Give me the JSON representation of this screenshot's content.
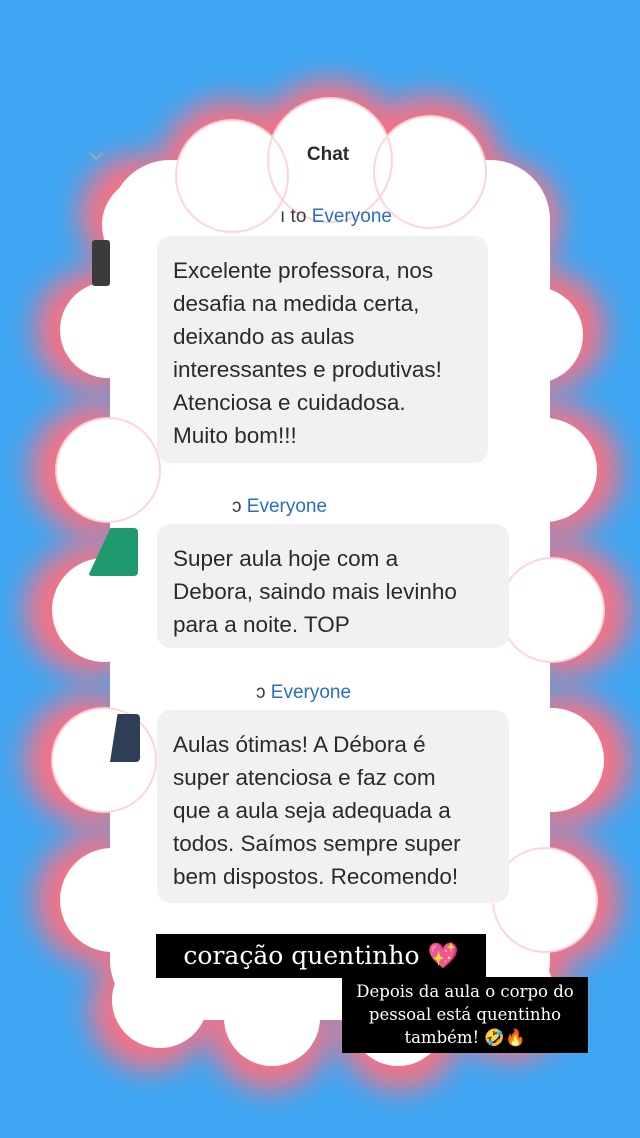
{
  "chat": {
    "title": "Chat",
    "messages": [
      {
        "to_prefix": "ı to",
        "recipient": "Everyone",
        "lines": [
          "Excelente professora, nos",
          "desafia na medida certa,",
          "deixando as aulas",
          "interessantes e produtivas!",
          "Atenciosa e  cuidadosa.",
          "Muito bom!!!"
        ]
      },
      {
        "to_prefix": "ɔ",
        "recipient": "Everyone",
        "lines": [
          "Super aula hoje com a",
          "Debora, saindo mais levinho",
          "para a noite. TOP"
        ]
      },
      {
        "to_prefix": "ɔ",
        "recipient": "Everyone",
        "lines": [
          "Aulas ótimas! A Débora é",
          "super atenciosa e faz com",
          "que a aula seja adequada a",
          "todos. Saímos sempre super",
          "bem dispostos. Recomendo!"
        ]
      }
    ]
  },
  "overlay": {
    "caption": "coração quentinho 💖",
    "subcaption_lines": [
      "Depois da aula o corpo do",
      "pessoal está quentinho",
      "também! 🤣🔥"
    ]
  },
  "colors": {
    "background": "#3ea6f2",
    "cloud_glow": "#ff6f7f",
    "bubble": "#f1f1f4",
    "recipient_link": "#2a6fbf"
  }
}
